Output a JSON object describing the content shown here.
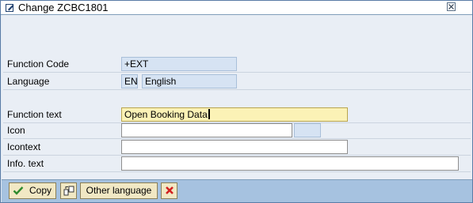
{
  "window": {
    "title": "Change ZCBC1801"
  },
  "icons": {
    "title": "edit-window-icon",
    "close": "close-icon",
    "copy": "checkmark-icon",
    "other": "transfer-icon",
    "cancel": "cancel-x-icon"
  },
  "fields": {
    "function_code": {
      "label": "Function Code",
      "value": "+EXT"
    },
    "language": {
      "label": "Language",
      "code": "EN",
      "name": "English"
    },
    "function_text": {
      "label": "Function text",
      "value": "Open Booking Data"
    },
    "icon": {
      "label": "Icon",
      "value": "",
      "extra": ""
    },
    "icontext": {
      "label": "Icontext",
      "value": ""
    },
    "info_text": {
      "label": "Info. text",
      "value": ""
    }
  },
  "toolbar": {
    "copy_label": "Copy",
    "other_language_label": "Other language"
  },
  "colors": {
    "required_field": "#fbf2b6",
    "readonly_field": "#d6e3f3",
    "toolbar": "#a6c2e0"
  }
}
